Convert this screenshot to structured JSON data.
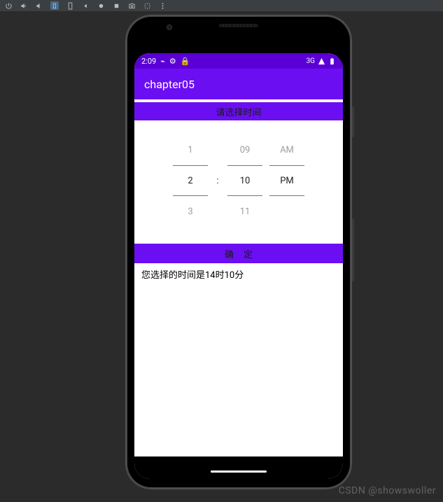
{
  "emulator_toolbar": {
    "buttons": [
      {
        "name": "power-icon"
      },
      {
        "name": "volume-up-icon"
      },
      {
        "name": "volume-down-icon"
      },
      {
        "name": "rotate-left-icon"
      },
      {
        "name": "rotate-right-icon"
      },
      {
        "name": "back-icon"
      },
      {
        "name": "circle-icon"
      },
      {
        "name": "square-icon"
      },
      {
        "name": "camera-icon"
      },
      {
        "name": "record-icon"
      },
      {
        "name": "more-icon"
      }
    ]
  },
  "status_bar": {
    "time": "2:09",
    "network": "3G"
  },
  "app_bar": {
    "title": "chapter05"
  },
  "section_header": {
    "label": "请选择时间"
  },
  "time_picker": {
    "hour": {
      "prev": "1",
      "selected": "2",
      "next": "3"
    },
    "separator": ":",
    "minute": {
      "prev": "09",
      "selected": "10",
      "next": "11"
    },
    "ampm": {
      "prev": "AM",
      "selected": "PM",
      "next": ""
    }
  },
  "confirm": {
    "label": "确定"
  },
  "result": {
    "text": "您选择的时间是14时10分"
  },
  "watermark": {
    "text": "CSDN @showswoller"
  }
}
